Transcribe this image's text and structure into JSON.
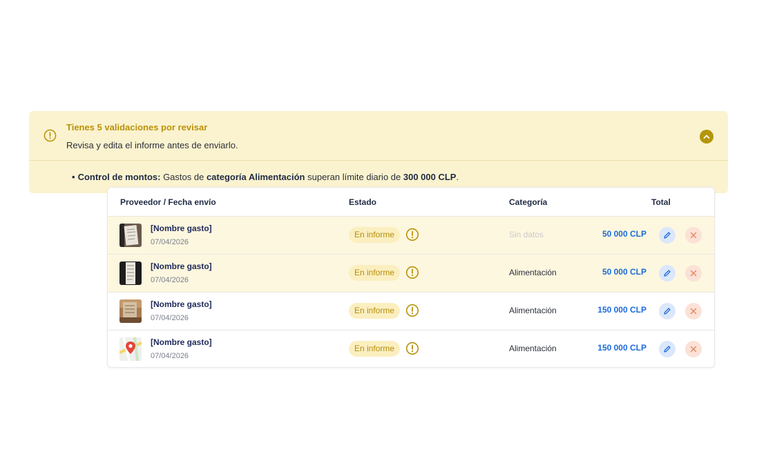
{
  "alert": {
    "title": "Tienes 5 validaciones por revisar",
    "subtitle": "Revisa y edita el informe antes de enviarlo.",
    "rule": {
      "label": "Control de montos:",
      "text_1": " Gastos de ",
      "category": "categoría Alimentación",
      "text_2": " superan límite diario de ",
      "limit": "300 000 CLP",
      "end": "."
    },
    "colors": {
      "background": "#fbf3cf",
      "accent": "#b3960a"
    }
  },
  "table": {
    "headers": {
      "provider": "Proveedor / Fecha envío",
      "status": "Estado",
      "category": "Categoría",
      "total": "Total"
    },
    "rows": [
      {
        "name": "[Nombre gasto]",
        "date": "07/04/2026",
        "status": "En informe",
        "category": "Sin datos",
        "total": "50 000 CLP",
        "thumb": "receipt-photo-icon"
      },
      {
        "name": "[Nombre gasto]",
        "date": "07/04/2026",
        "status": "En informe",
        "category": "Alimentación",
        "total": "50 000 CLP",
        "thumb": "receipt-photo-icon"
      },
      {
        "name": "[Nombre gasto]",
        "date": "07/04/2026",
        "status": "En informe",
        "category": "Alimentación",
        "total": "150 000 CLP",
        "thumb": "receipt-photo-icon"
      },
      {
        "name": "[Nombre gasto]",
        "date": "07/04/2026",
        "status": "En informe",
        "category": "Alimentación",
        "total": "150 000 CLP",
        "thumb": "map-pin-icon"
      }
    ],
    "colors": {
      "total": "#1c6ad8",
      "warn_row": "#fdf7df"
    }
  }
}
